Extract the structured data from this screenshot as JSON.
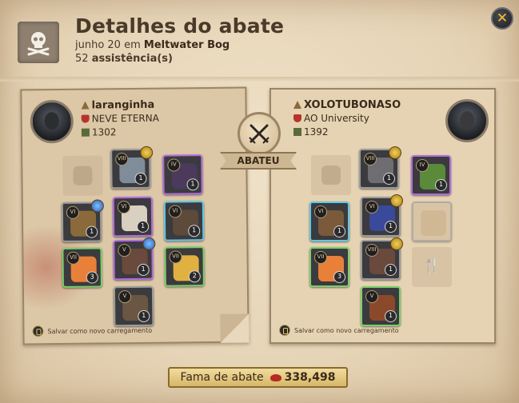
{
  "window": {
    "title": "Detalhes do abate",
    "close_icon": "close-icon"
  },
  "header": {
    "date_prefix": "junho 20 em",
    "location": "Meltwater Bog",
    "assists_count": "52",
    "assists_label": "assistência(s)"
  },
  "killer": {
    "name": "laranginha",
    "guild": "NEVE ETERNA",
    "item_power": "1302",
    "save_label": "Salvar como novo carregamento",
    "slots": [
      {
        "item": "bag",
        "empty": true
      },
      {
        "item": "hood",
        "tier": "VIII",
        "qty": "1",
        "quality": "gray",
        "enchant": "plus",
        "color": "#7f8c9a"
      },
      {
        "item": "cape",
        "tier": "IV",
        "qty": "1",
        "quality": "purple",
        "color": "#4b3a5c"
      },
      {
        "item": "crossbow",
        "tier": "VI",
        "qty": "1",
        "quality": "gray",
        "enchant": "star",
        "color": "#8a6a3a"
      },
      {
        "item": "plate-armor",
        "tier": "VI",
        "qty": "1",
        "quality": "purple",
        "color": "#d9d0c2"
      },
      {
        "item": "shield",
        "tier": "VI",
        "qty": "1",
        "quality": "blue",
        "color": "#5d4a3a"
      },
      {
        "item": "potion",
        "tier": "VII",
        "qty": "3",
        "quality": "green",
        "color": "#e8803a"
      },
      {
        "item": "boots",
        "tier": "V",
        "qty": "1",
        "quality": "purple",
        "enchant": "star",
        "color": "#6a4a3c"
      },
      {
        "item": "omelette",
        "tier": "VII",
        "qty": "2",
        "quality": "green",
        "color": "#e0b040"
      },
      {
        "item": "mount",
        "tier": "V",
        "qty": "1",
        "quality": "gray",
        "color": "#6a5642"
      }
    ]
  },
  "badge": {
    "label": "ABATEU",
    "icon": "crossed-swords-icon"
  },
  "victim": {
    "name": "XOLOTUBONASO",
    "guild": "AO University",
    "item_power": "1392",
    "save_label": "Salvar como novo carregamento",
    "slots": [
      {
        "item": "bag",
        "empty": true
      },
      {
        "item": "helmet",
        "tier": "VIII",
        "qty": "1",
        "quality": "gray",
        "enchant": "plus",
        "color": "#6e6e72"
      },
      {
        "item": "cape",
        "tier": "IV",
        "qty": "1",
        "quality": "purple",
        "color": "#5a8a3a"
      },
      {
        "item": "crossbow",
        "tier": "VI",
        "qty": "1",
        "quality": "blue",
        "color": "#7a5a3a"
      },
      {
        "item": "robe",
        "tier": "VI",
        "qty": "1",
        "quality": "gray",
        "enchant": "plus",
        "color": "#3a4a9a"
      },
      {
        "item": "crossbow-offhand",
        "tier": "",
        "qty": "",
        "quality": "gray",
        "faded": true,
        "color": "#c9ae88"
      },
      {
        "item": "potion",
        "tier": "VII",
        "qty": "3",
        "quality": "green",
        "color": "#e8803a"
      },
      {
        "item": "boots",
        "tier": "VIII",
        "qty": "1",
        "quality": "gray",
        "enchant": "plus",
        "color": "#6a4a3c"
      },
      {
        "item": "food",
        "empty": true,
        "cutlery": true
      },
      {
        "item": "mount",
        "tier": "V",
        "qty": "1",
        "quality": "green",
        "color": "#8a4a2a"
      }
    ]
  },
  "fame": {
    "label": "Fama de abate",
    "value": "338,498"
  }
}
